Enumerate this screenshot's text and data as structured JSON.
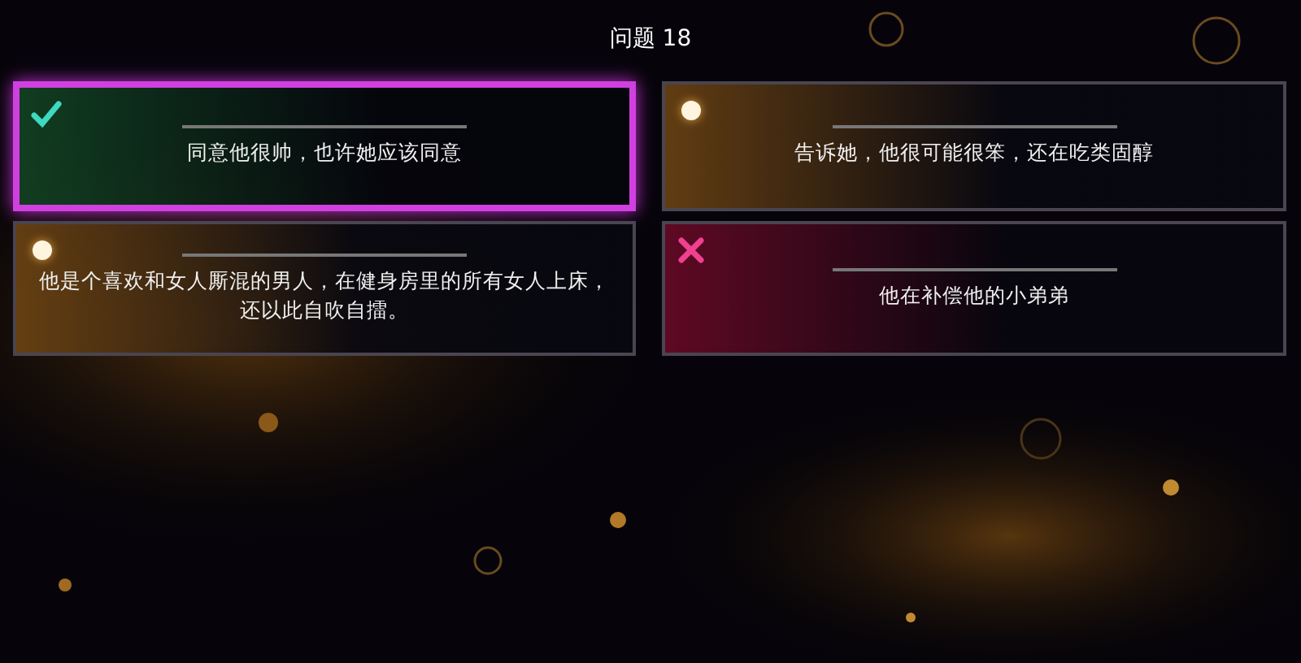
{
  "question": {
    "title": "问题 18"
  },
  "answers": [
    {
      "text": "同意他很帅，也许她应该同意",
      "kind": "correct",
      "selected": true
    },
    {
      "text": "告诉她，他很可能很笨，还在吃类固醇",
      "kind": "neutral",
      "selected": false
    },
    {
      "text": "他是个喜欢和女人厮混的男人，在健身房里的所有女人上床，还以此自吹自擂。",
      "kind": "neutral",
      "selected": false
    },
    {
      "text": "他在补偿他的小弟弟",
      "kind": "wrong",
      "selected": false
    }
  ]
}
